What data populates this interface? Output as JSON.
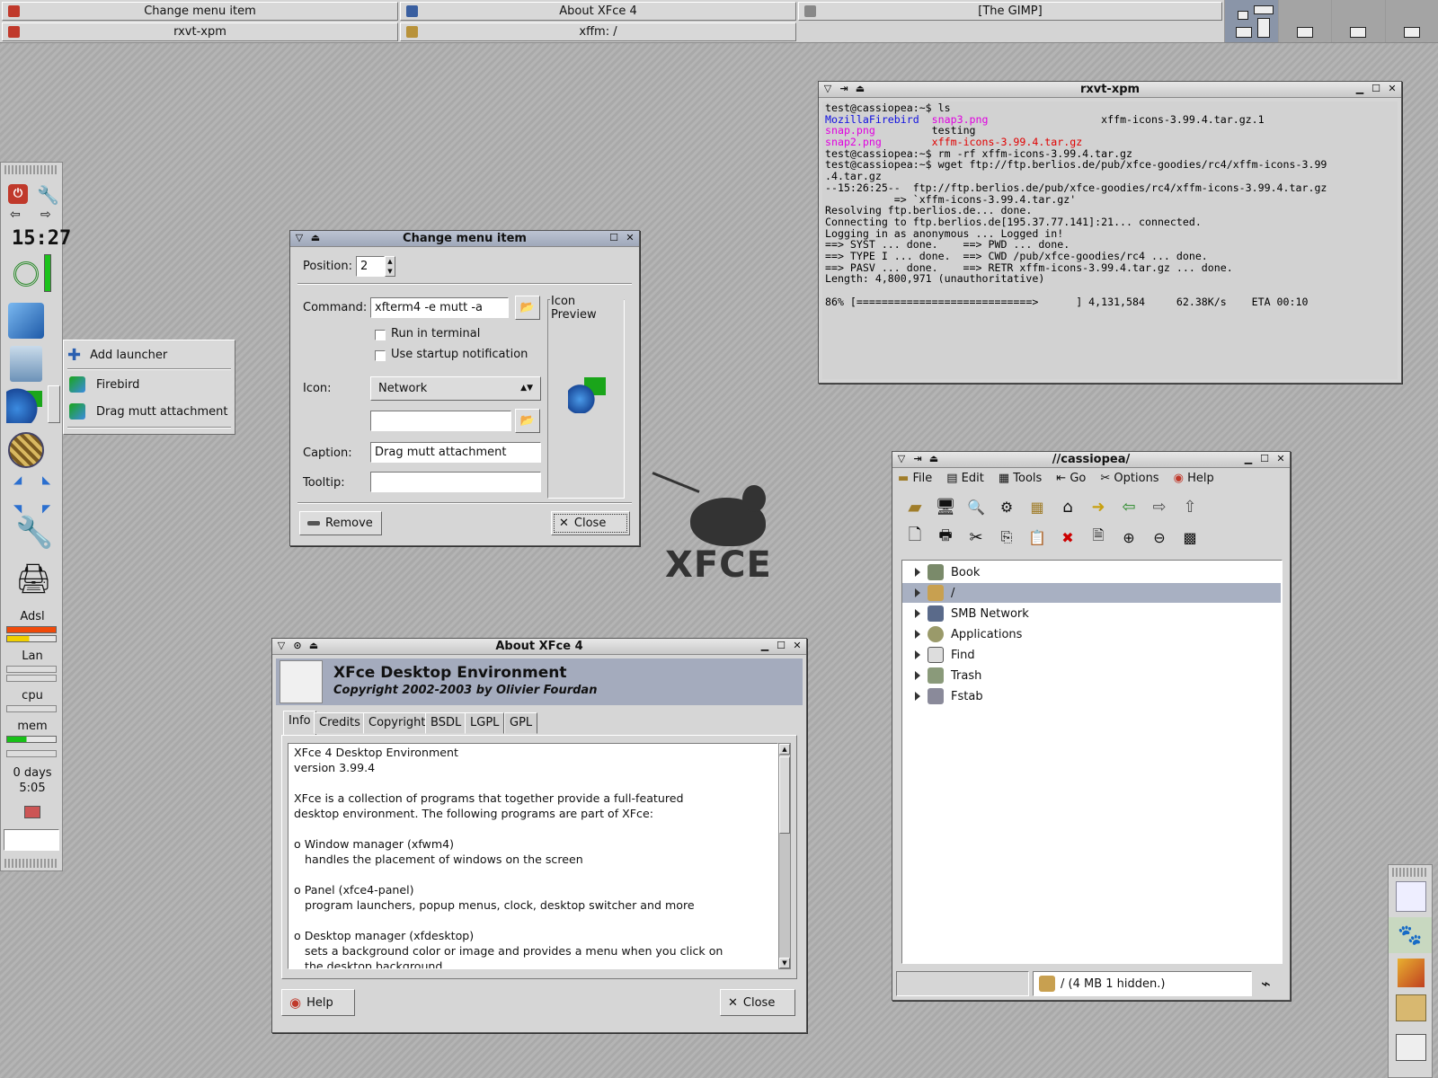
{
  "taskbar": {
    "tasks": [
      {
        "label": "Change menu item",
        "color": "#c0392b"
      },
      {
        "label": "About XFce 4",
        "color": "#3a5fa0"
      },
      {
        "label": "[The GIMP]",
        "color": "#888888"
      },
      {
        "label": "rxvt-xpm",
        "color": "#c0392b"
      },
      {
        "label": "xffm:  /",
        "color": "#b8923a"
      }
    ]
  },
  "panel": {
    "clock": "15:27",
    "adsl": "Adsl",
    "lan": "Lan",
    "cpu": "cpu",
    "mem": "mem",
    "uptime_days": "0 days",
    "uptime_time": "5:05"
  },
  "popup_menu": {
    "items": [
      "Add launcher",
      "Firebird",
      "Drag mutt attachment"
    ]
  },
  "change_menu": {
    "title": "Change menu item",
    "position_label": "Position:",
    "position_value": "2",
    "command_label": "Command:",
    "command_value": "xfterm4 -e mutt -a",
    "run_in_terminal": "Run in terminal",
    "startup_notification": "Use startup notification",
    "icon_label": "Icon:",
    "icon_value": "Network",
    "icon_path_value": "",
    "caption_label": "Caption:",
    "caption_value": "Drag mutt attachment",
    "tooltip_label": "Tooltip:",
    "tooltip_value": "",
    "preview_label": "Icon Preview",
    "remove": "Remove",
    "close": "Close"
  },
  "logo": {
    "text": "XFCE"
  },
  "terminal": {
    "title": "rxvt-xpm",
    "lines": [
      "test@cassiopea:~$ ls",
      "MozillaFirebird  snap3.png                  xffm-icons-3.99.4.tar.gz.1",
      "snap.png         testing",
      "snap2.png        xffm-icons-3.99.4.tar.gz",
      "test@cassiopea:~$ rm -rf xffm-icons-3.99.4.tar.gz",
      "test@cassiopea:~$ wget ftp://ftp.berlios.de/pub/xfce-goodies/rc4/xffm-icons-3.99",
      ".4.tar.gz",
      "--15:26:25--  ftp://ftp.berlios.de/pub/xfce-goodies/rc4/xffm-icons-3.99.4.tar.gz",
      "           => `xffm-icons-3.99.4.tar.gz'",
      "Resolving ftp.berlios.de... done.",
      "Connecting to ftp.berlios.de[195.37.77.141]:21... connected.",
      "Logging in as anonymous ... Logged in!",
      "==> SYST ... done.    ==> PWD ... done.",
      "==> TYPE I ... done.  ==> CWD /pub/xfce-goodies/rc4 ... done.",
      "==> PASV ... done.    ==> RETR xffm-icons-3.99.4.tar.gz ... done.",
      "Length: 4,800,971 (unauthoritative)",
      "",
      "86% [============================>      ] 4,131,584     62.38K/s    ETA 00:10"
    ],
    "colors": {
      "blue": "#1010e0",
      "magenta": "#e000e0",
      "red": "#e00000"
    }
  },
  "filemanager": {
    "title": "//cassiopea/",
    "menu": [
      "File",
      "Edit",
      "Tools",
      "Go",
      "Options",
      "Help"
    ],
    "tree": [
      "Book",
      "/",
      "SMB Network",
      "Applications",
      "Find",
      "Trash",
      "Fstab"
    ],
    "status": "/ (4 MB 1 hidden.)"
  },
  "about": {
    "title": "About XFce 4",
    "heading": "XFce Desktop Environment",
    "copyright": "Copyright 2002-2003 by Olivier Fourdan",
    "tabs": [
      "Info",
      "Credits",
      "Copyright",
      "BSDL",
      "LGPL",
      "GPL"
    ],
    "text": [
      "XFce 4 Desktop Environment",
      "version 3.99.4",
      "",
      "XFce is a collection of programs that together provide a full-featured",
      "desktop environment. The following programs are part of XFce:",
      "",
      "o Window manager (xfwm4)",
      "   handles the placement of windows on the screen",
      "",
      "o Panel (xfce4-panel)",
      "   program launchers, popup menus, clock, desktop switcher and more",
      "",
      "o Desktop manager (xfdesktop)",
      "   sets a background color or image and provides a menu when you click on",
      "   the desktop background"
    ],
    "help": "Help",
    "close": "Close"
  }
}
